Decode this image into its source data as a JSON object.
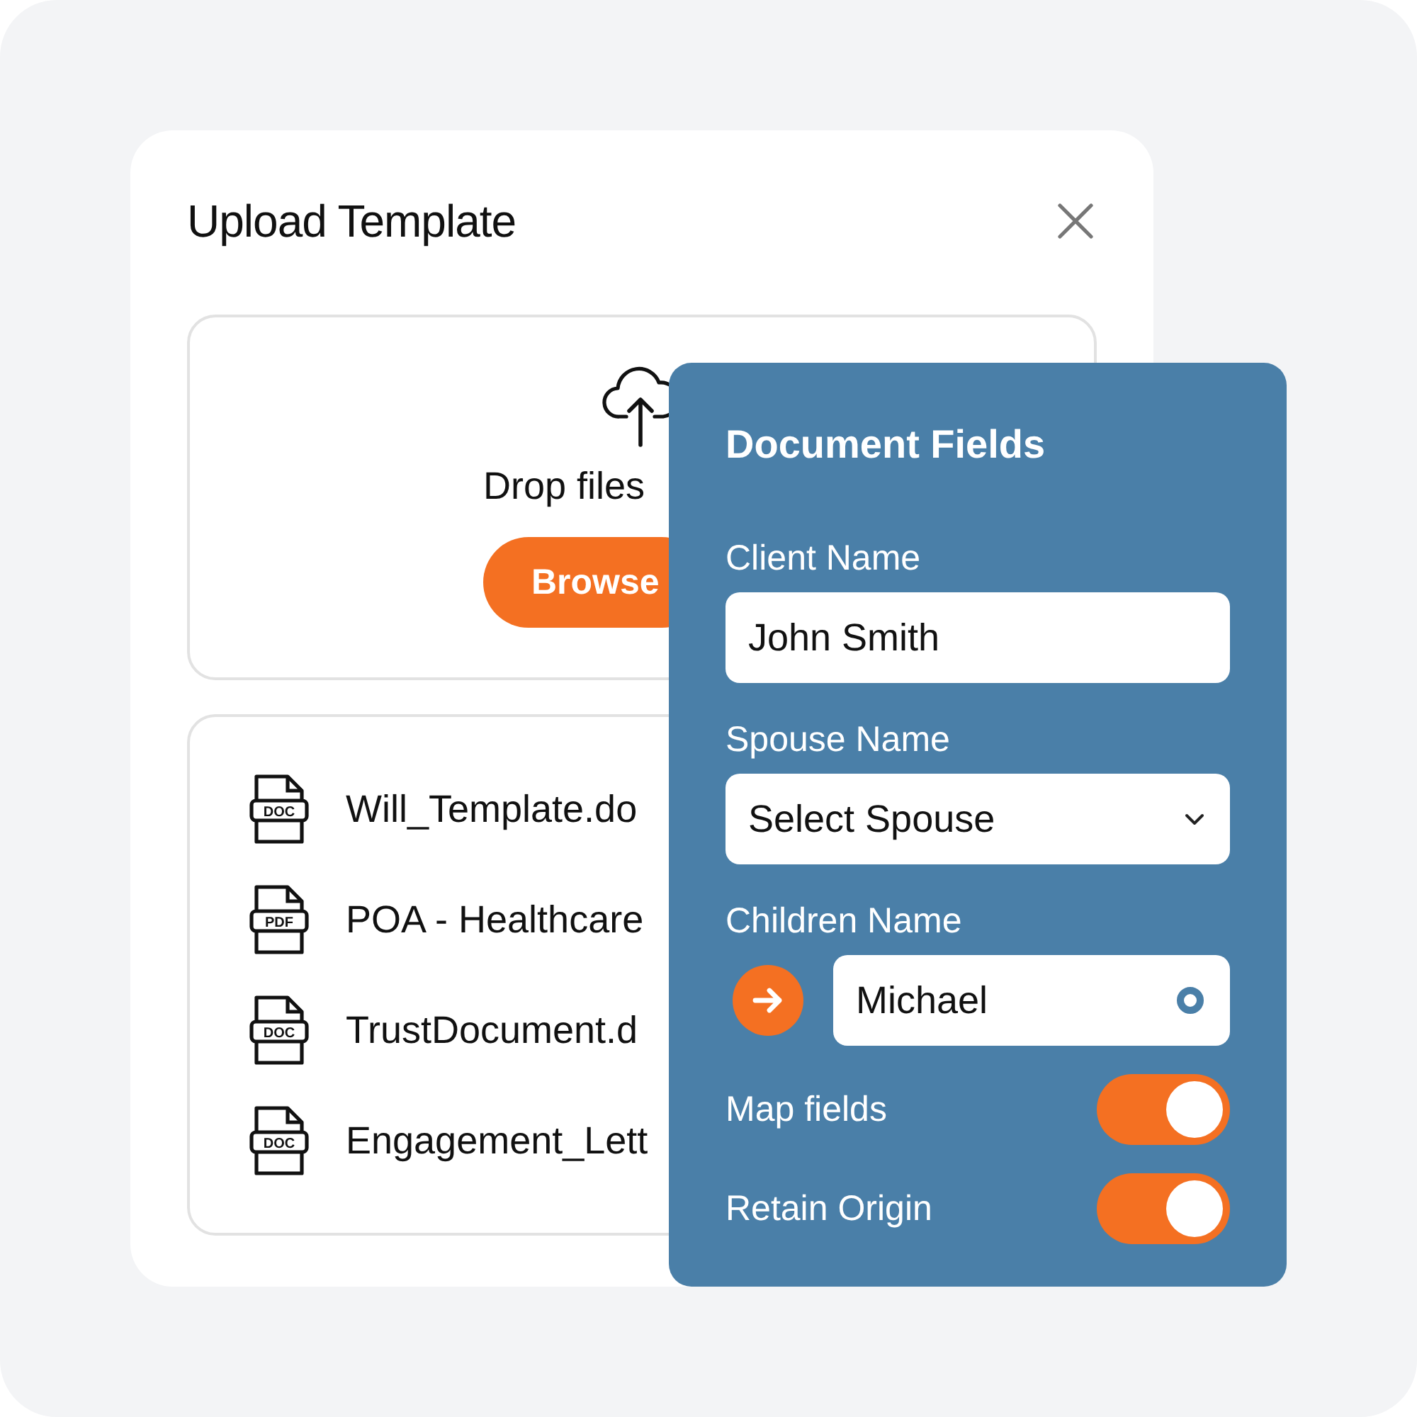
{
  "dialog": {
    "title": "Upload Template"
  },
  "dropzone": {
    "text": "Drop files",
    "button": "Browse"
  },
  "files": [
    {
      "name": "Will_Template.do",
      "type": "DOC"
    },
    {
      "name": "POA - Healthcare",
      "type": "PDF"
    },
    {
      "name": "TrustDocument.d",
      "type": "DOC"
    },
    {
      "name": "Engagement_Lett",
      "type": "DOC"
    }
  ],
  "panel": {
    "title": "Document Fields",
    "fields": [
      {
        "kind": "text",
        "label": "Client Name",
        "value": "John Smith"
      },
      {
        "kind": "select",
        "label": "Spouse Name",
        "value": "Select Spouse"
      },
      {
        "kind": "child",
        "label": "Children Name",
        "value": "Michael"
      }
    ],
    "toggles": [
      {
        "label": "Map fields",
        "on": true
      },
      {
        "label": "Retain Origin",
        "on": true
      }
    ]
  }
}
